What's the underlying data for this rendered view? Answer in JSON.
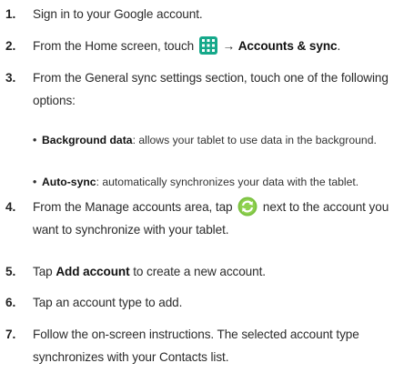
{
  "steps": [
    {
      "num": "1.",
      "text": "Sign in to your Google account."
    },
    {
      "num": "2.",
      "pre": "From the Home screen, touch",
      "arrow": "→",
      "bold": "Accounts & sync",
      "post": ".",
      "icon": "apps-grid-icon"
    },
    {
      "num": "3.",
      "text": "From the General sync settings section, touch one of the following options:"
    },
    {
      "num": "4.",
      "pre": "From the Manage accounts area, tap",
      "post": "next to the account you want to synchronize with your tablet.",
      "icon": "sync-icon"
    },
    {
      "num": "5.",
      "pre": "Tap",
      "bold": "Add account",
      "post": "to create a new account."
    },
    {
      "num": "6.",
      "text": "Tap an account type to add."
    },
    {
      "num": "7.",
      "text": "Follow the on-screen instructions. The selected account type synchronizes with your Contacts list."
    }
  ],
  "bullets": [
    {
      "dot": "•",
      "term": "Background data",
      "desc": ": allows your tablet to use data in the background."
    },
    {
      "dot": "•",
      "term": "Auto-sync",
      "desc": ": automatically synchronizes your data with the tablet."
    }
  ],
  "colors": {
    "apps_icon": "#15a88a",
    "sync_icon": "#7cc242"
  }
}
